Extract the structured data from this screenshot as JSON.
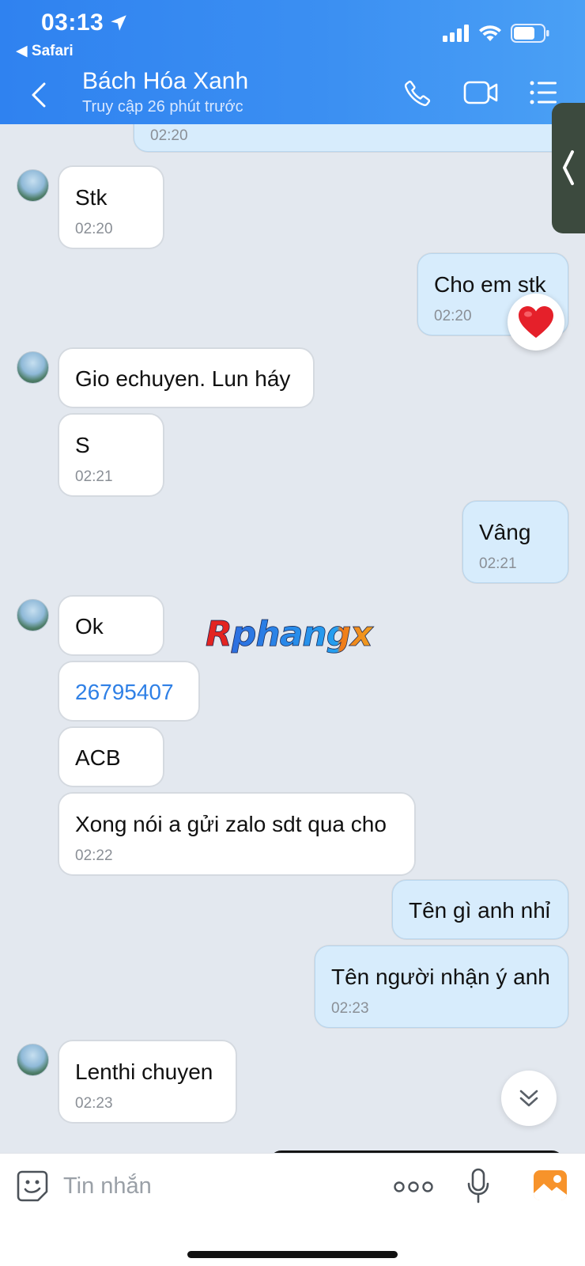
{
  "status_bar": {
    "time": "03:13",
    "back_app": "◀ Safari"
  },
  "header": {
    "title": "Bách Hóa Xanh",
    "subtitle": "Truy cập 26 phút trước"
  },
  "messages": [
    {
      "side": "out",
      "text": "",
      "time": "02:20"
    },
    {
      "side": "in",
      "text": "Stk",
      "time": "02:20"
    },
    {
      "side": "out",
      "text": "Cho em stk",
      "time": "02:20",
      "reaction": "heart"
    },
    {
      "side": "in",
      "text": "Gio echuyen. Lun háy",
      "time": ""
    },
    {
      "side": "in",
      "text": "S",
      "time": "02:21"
    },
    {
      "side": "out",
      "text": "Vâng",
      "time": "02:21"
    },
    {
      "side": "in",
      "text": "Ok",
      "time": ""
    },
    {
      "side": "in",
      "text": "26795407",
      "time": "",
      "link": true
    },
    {
      "side": "in",
      "text": "ACB",
      "time": ""
    },
    {
      "side": "in",
      "text": "Xong nói a gửi zalo sdt qua cho",
      "time": "02:22"
    },
    {
      "side": "out",
      "text": "Tên gì anh nhỉ",
      "time": ""
    },
    {
      "side": "out",
      "text": "Tên người nhận ý anh",
      "time": "02:23"
    },
    {
      "side": "in",
      "text": "Lenthi chuyen",
      "time": "02:23"
    }
  ],
  "watermark": "Rphangx",
  "composer": {
    "placeholder": "Tin nhắn"
  },
  "colors": {
    "header": "#2f82f0",
    "incoming": "#ffffff",
    "outgoing": "#d7ecfc",
    "link": "#2f80e6",
    "background": "#e3e8ef"
  }
}
